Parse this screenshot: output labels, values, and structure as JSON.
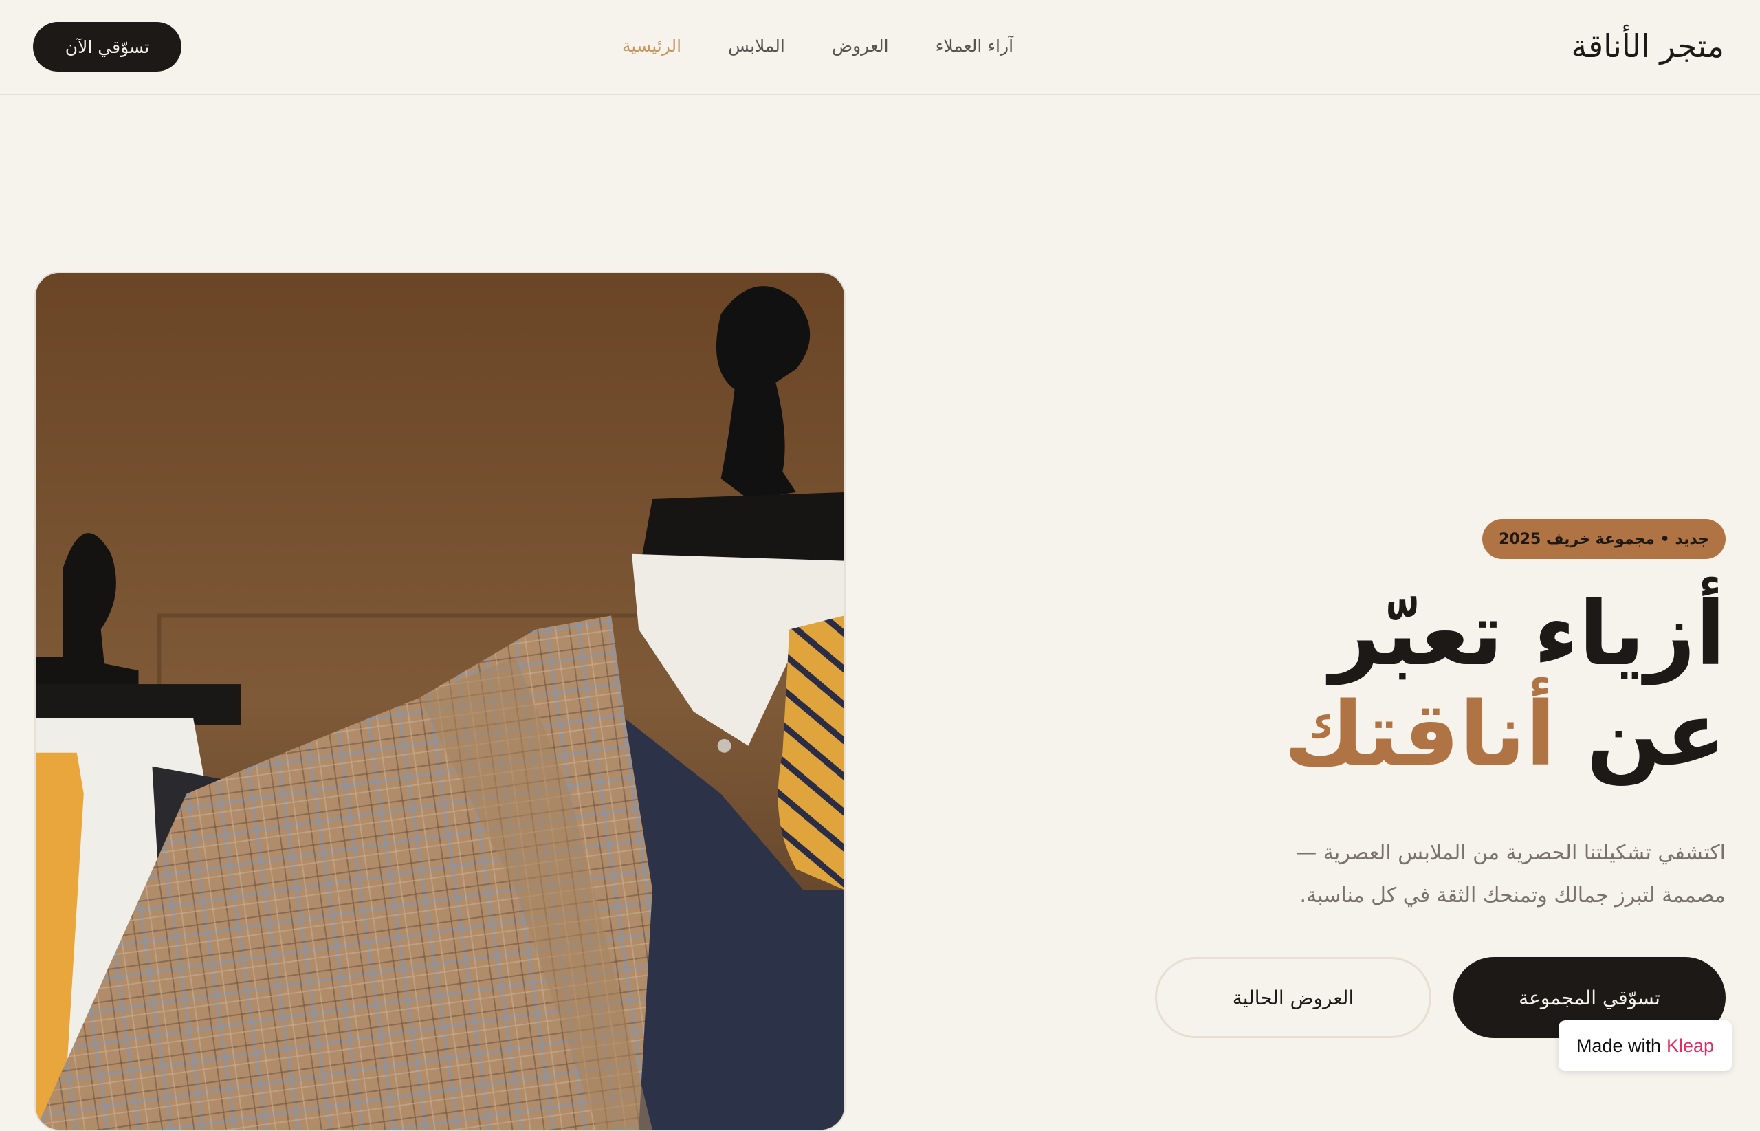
{
  "header": {
    "logo": "متجر الأناقة",
    "nav": [
      {
        "label": "الرئيسية",
        "active": true
      },
      {
        "label": "الملابس",
        "active": false
      },
      {
        "label": "العروض",
        "active": false
      },
      {
        "label": "آراء العملاء",
        "active": false
      }
    ],
    "cta": "تسوّقي الآن"
  },
  "hero": {
    "badge": "جديد • مجموعة خريف 2025",
    "headline_line1": "أزياء تعبّر",
    "headline_line2_prefix": "عن ",
    "headline_line2_accent": "أناقتك",
    "subtitle_line1": "اكتشفي تشكيلتنا الحصرية من الملابس العصرية —",
    "subtitle_line2": "مصممة لتبرز جمالك وتمنحك الثقة في كل مناسبة.",
    "primary_button": "تسوّقي المجموعة",
    "secondary_button": "العروض الحالية",
    "image": "mannequins-in-suits-photo"
  },
  "badge_made_with": {
    "prefix": "Made with",
    "brand": "Kleap"
  },
  "colors": {
    "background": "#f6f3ed",
    "text": "#1c1917",
    "accent": "#b07444",
    "nav_active": "#c8955f"
  }
}
